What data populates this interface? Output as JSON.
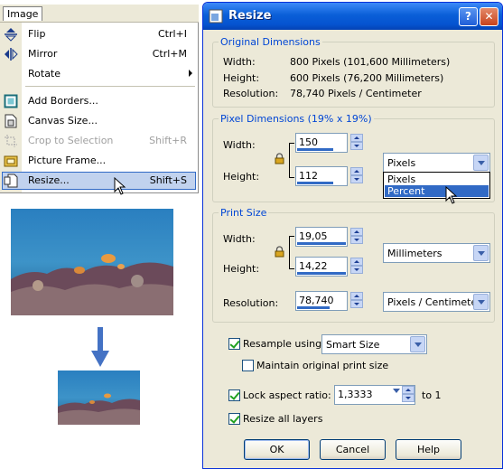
{
  "menu": {
    "title": "Image",
    "items": [
      {
        "label": "Flip",
        "shortcut": "Ctrl+I",
        "icon": "flip-icon",
        "disabled": false
      },
      {
        "label": "Mirror",
        "shortcut": "Ctrl+M",
        "icon": "mirror-icon",
        "disabled": false
      },
      {
        "label": "Rotate",
        "shortcut": "",
        "icon": "",
        "disabled": false,
        "submenu": true
      },
      {
        "label": "Add Borders...",
        "shortcut": "",
        "icon": "add-borders-icon",
        "disabled": false
      },
      {
        "label": "Canvas Size...",
        "shortcut": "",
        "icon": "canvas-size-icon",
        "disabled": false
      },
      {
        "label": "Crop to Selection",
        "shortcut": "Shift+R",
        "icon": "crop-icon",
        "disabled": true
      },
      {
        "label": "Picture Frame...",
        "shortcut": "",
        "icon": "picture-frame-icon",
        "disabled": false
      },
      {
        "label": "Resize...",
        "shortcut": "Shift+S",
        "icon": "resize-icon",
        "disabled": false,
        "highlighted": true
      }
    ]
  },
  "dialog": {
    "title": "Resize",
    "help_btn": "?",
    "close_btn": "✕",
    "original": {
      "legend": "Original Dimensions",
      "width_label": "Width:",
      "width_value": "800 Pixels (101,600 Millimeters)",
      "height_label": "Height:",
      "height_value": "600 Pixels (76,200 Millimeters)",
      "resolution_label": "Resolution:",
      "resolution_value": "78,740 Pixels / Centimeter"
    },
    "pixel": {
      "legend": "Pixel Dimensions (19% x 19%)",
      "width_label": "Width:",
      "width_value": "150",
      "height_label": "Height:",
      "height_value": "112",
      "unit_selected": "Pixels",
      "unit_options": [
        "Pixels",
        "Percent"
      ],
      "unit_highlighted": "Percent"
    },
    "print": {
      "legend": "Print Size",
      "width_label": "Width:",
      "width_value": "19,05",
      "height_label": "Height:",
      "height_value": "14,22",
      "unit_selected": "Millimeters",
      "resolution_label": "Resolution:",
      "resolution_value": "78,740",
      "resolution_unit": "Pixels / Centimeter"
    },
    "resample": {
      "label": "Resample using:",
      "checked": true,
      "method": "Smart Size"
    },
    "maintain": {
      "label": "Maintain original print size",
      "checked": false
    },
    "lock": {
      "label": "Lock aspect ratio:",
      "checked": true,
      "value": "1,3333",
      "suffix": "to 1"
    },
    "resize_layers": {
      "label": "Resize all layers",
      "checked": true
    },
    "buttons": {
      "ok": "OK",
      "cancel": "Cancel",
      "help": "Help"
    }
  }
}
